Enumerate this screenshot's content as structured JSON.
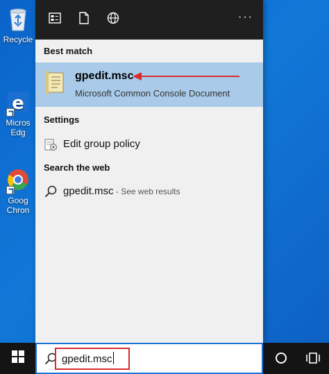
{
  "desktop": {
    "icons": [
      {
        "label": "Recycle",
        "icon": "recycle-bin-icon"
      },
      {
        "label": "Micros\nEdg",
        "icon": "edge-icon"
      },
      {
        "label": "Goog\nChron",
        "icon": "chrome-icon"
      }
    ]
  },
  "start_panel": {
    "top_buttons": [
      {
        "icon": "apps-icon"
      },
      {
        "icon": "documents-icon"
      },
      {
        "icon": "web-globe-icon"
      }
    ],
    "more_label": "···",
    "best_match": {
      "header": "Best match",
      "title": "gpedit.msc",
      "subtitle": "Microsoft Common Console Document",
      "icon": "console-document-icon",
      "highlight_color": "#a9cbe9",
      "annotation_arrow_color": "#d72c2c"
    },
    "settings": {
      "header": "Settings",
      "items": [
        {
          "label": "Edit group policy",
          "icon": "group-policy-icon"
        }
      ]
    },
    "web": {
      "header": "Search the web",
      "items": [
        {
          "label": "gpedit.msc",
          "suffix": " - See web results",
          "icon": "search-icon"
        }
      ]
    }
  },
  "taskbar": {
    "start_icon": "windows-logo-icon",
    "search": {
      "value": "gpedit.msc",
      "icon": "search-icon",
      "highlight_color": "#d72c2c"
    },
    "cortana_icon": "cortana-circle-icon",
    "task_view_icon": "task-view-icon"
  }
}
